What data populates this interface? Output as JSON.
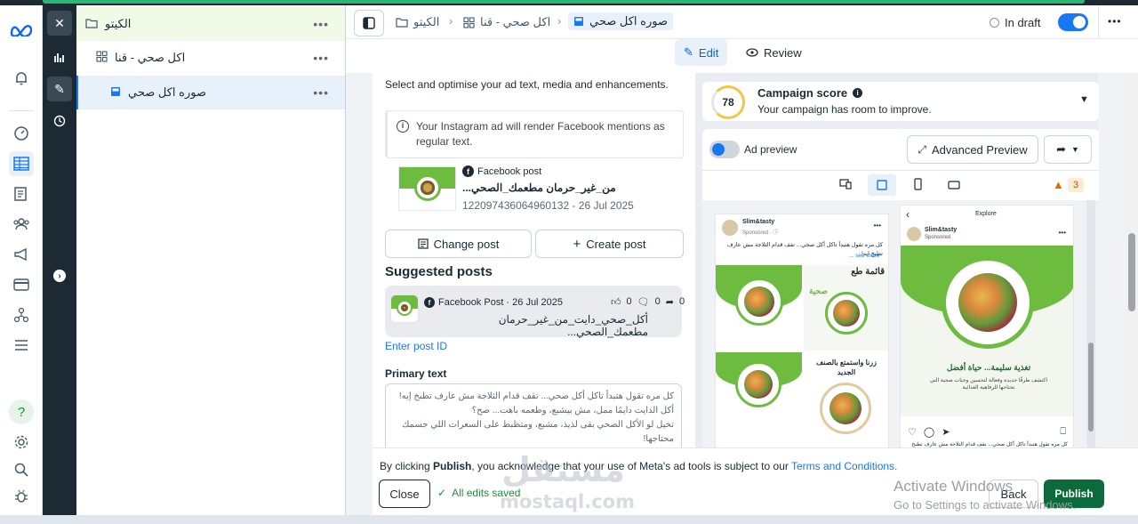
{
  "rail": {
    "icons": [
      "meta-logo-icon",
      "bell-icon",
      "gauge-icon",
      "table-icon",
      "pages-icon",
      "audience-icon",
      "megaphone-icon",
      "billing-card-icon",
      "network-icon",
      "menu-icon",
      "help-icon",
      "settings-gear-icon",
      "search-icon",
      "bug-icon"
    ]
  },
  "tree": {
    "campaign": "الكيتو",
    "adset": "اكل صحي - قنا",
    "ad": "صوره اكل صحي",
    "more": "•••"
  },
  "header": {
    "crumbs": [
      "الكيتو",
      "اكل صحي - قنا",
      "صوره اكل صحي"
    ],
    "status": "In draft",
    "more": "•••"
  },
  "tabs": {
    "edit": "Edit",
    "review": "Review"
  },
  "form": {
    "intro": "Select and optimise your ad text, media and enhancements.",
    "notice": "Your Instagram ad will render Facebook mentions as regular text.",
    "post": {
      "source": "Facebook post",
      "title": "من_غير_حرمان مطعمك_الصحي...",
      "meta": "122097436064960132 - 26 Jul 2025"
    },
    "change_post": "Change post",
    "create_post": "Create post",
    "suggested_heading": "Suggested posts",
    "suggested": {
      "source": "Facebook Post · 26 Jul 2025",
      "text": "أكل_صحي_دايت_من_غير_حرمان مطعمك_الصحي...",
      "likes": "0",
      "comments": "0",
      "shares": "0"
    },
    "enter_post_id": "Enter post ID",
    "primary_text_label": "Primary text",
    "primary_text": "كل مره تقول هتبدأ تاكل أكل صحي... تقف قدام الثلاجة مش عارف تطبخ إيه!\nأكل الدايت دايمًا ممل، مش بيشبع، وطعمه باهت... صح؟\nتخيل لو الأكل الصحي بقى لذيذ، مشبع، ومتظبط على السعرات اللي جسمك محتاجها!"
  },
  "preview": {
    "score": "78",
    "score_title": "Campaign score",
    "score_sub": "Your campaign has room to improve.",
    "ad_preview": "Ad preview",
    "advanced_preview": "Advanced Preview",
    "warnings": "3",
    "fb": {
      "page": "Slim&tasty",
      "sponsored": "Sponsored · ⓘ",
      "caption": "كل مره تقول هتبدأ تاكل أكل صحي... تقف قدام الثلاجة مش عارف تطبخ إيه!",
      "see_more": "... see more",
      "tile_heading": "قائمة طع",
      "tile_sub": "صحية",
      "tile_label": "زرنا واستمتع بالصنف الجديد"
    },
    "ig": {
      "back": "‹",
      "title": "Explore",
      "page": "Slim&tasty",
      "sponsored": "Sponsored",
      "headline": "تغذية سليمة... حياة أفضل",
      "body": "اكتشف طرقًا جديدة وفعالة لتحسين وجبات صحية التي تحتاجها للرفاهية الغذائية",
      "caption": "كل مره تقول هتبدأ تاكل أكل صحي... تقف قدام الثلاجة مش عارف تطبخ"
    }
  },
  "footer": {
    "pre": "By clicking ",
    "publish_word": "Publish",
    "post": ", you acknowledge that your use of Meta's ad tools is subject to our ",
    "terms": "Terms and Conditions.",
    "close": "Close",
    "saved": "All edits saved",
    "back": "Back",
    "publish": "Publish",
    "activate_title": "Activate Windows",
    "activate_sub": "Go to Settings to activate Windows.",
    "watermark_ar": "مستقل",
    "watermark_en": "mostaql.com"
  },
  "colors": {
    "accent": "#1877f2",
    "publish": "#0b6b3a",
    "green": "#6dbb3f"
  }
}
